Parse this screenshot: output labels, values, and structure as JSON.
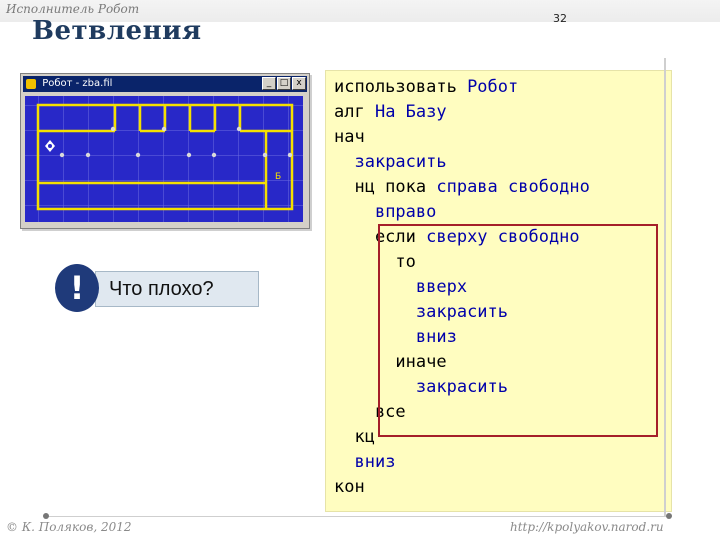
{
  "header": {
    "top_caption": "Исполнитель Робот",
    "page_number": "32",
    "title": "Ветвления"
  },
  "robot_window": {
    "title": "Робот - zba.fil",
    "buttons": {
      "minimize": "_",
      "maximize": "□",
      "close": "x"
    },
    "field_marker_letter": "Б"
  },
  "warning": {
    "mark": "!",
    "text": "Что плохо?"
  },
  "code": {
    "lines": [
      {
        "plain": "использовать ",
        "kw": "Робот"
      },
      {
        "plain": "алг ",
        "kw": "На Базу"
      },
      {
        "plain": "нач",
        "kw": ""
      },
      {
        "plain": "  ",
        "kw": "закрасить"
      },
      {
        "plain": "  нц пока ",
        "kw": "справа свободно"
      },
      {
        "plain": "    ",
        "kw": "вправо"
      },
      {
        "plain": "    если ",
        "kw": "сверху свободно"
      },
      {
        "plain": "      то",
        "kw": ""
      },
      {
        "plain": "        ",
        "kw": "вверх"
      },
      {
        "plain": "        ",
        "kw": "закрасить"
      },
      {
        "plain": "        ",
        "kw": "вниз"
      },
      {
        "plain": "      иначе",
        "kw": ""
      },
      {
        "plain": "        ",
        "kw": "закрасить"
      },
      {
        "plain": "    все",
        "kw": ""
      },
      {
        "plain": "  кц",
        "kw": ""
      },
      {
        "plain": "  ",
        "kw": "вниз"
      },
      {
        "plain": "кон",
        "kw": ""
      }
    ]
  },
  "footer": {
    "left": "© К. Поляков, 2012",
    "right": "http://kpolyakov.narod.ru"
  },
  "colors": {
    "title": "#1f3b5f",
    "code_background": "#fffdc0",
    "keyword": "#0000aa",
    "highlight_border": "#a51f2a",
    "robot_field": "#2828c8",
    "wall": "#f5e000"
  }
}
